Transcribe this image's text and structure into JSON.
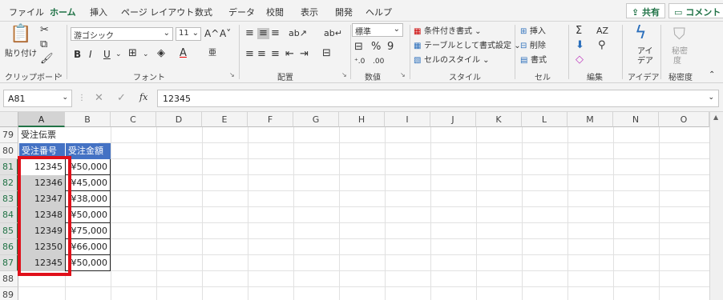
{
  "tabs": [
    "ファイル",
    "ホーム",
    "挿入",
    "ページ レイアウト",
    "数式",
    "データ",
    "校閲",
    "表示",
    "開発",
    "ヘルプ"
  ],
  "share_label": "共有",
  "comment_label": "コメント",
  "ribbon": {
    "clipboard": {
      "paste": "貼り付け",
      "group": "クリップボード"
    },
    "font": {
      "name": "游ゴシック",
      "size": "11",
      "grow": "A^",
      "shrink": "A˅",
      "bold": "B",
      "italic": "I",
      "underline": "U",
      "group": "フォント"
    },
    "alignment": {
      "group": "配置"
    },
    "number": {
      "format": "標準",
      "group": "数値"
    },
    "styles": {
      "conditional": "条件付き書式",
      "table": "テーブルとして書式設定",
      "cell": "セルのスタイル",
      "group": "スタイル"
    },
    "cells": {
      "insert": "挿入",
      "delete": "削除",
      "format": "書式",
      "group": "セル"
    },
    "editing": {
      "group": "編集"
    },
    "ideas": {
      "label1": "アイ",
      "label2": "デア",
      "group": "アイデア"
    },
    "sensitivity": {
      "label1": "秘密",
      "label2": "度",
      "group": "秘密度"
    }
  },
  "formula_bar": {
    "name_box": "A81",
    "fx": "fx",
    "value": "12345"
  },
  "columns": [
    "A",
    "B",
    "C",
    "D",
    "E",
    "F",
    "G",
    "H",
    "I",
    "J",
    "K",
    "L",
    "M",
    "N",
    "O"
  ],
  "rows": [
    "79",
    "80",
    "81",
    "82",
    "83",
    "84",
    "85",
    "86",
    "87",
    "88",
    "89"
  ],
  "sheet": {
    "title": "受注伝票",
    "header_a": "受注番号",
    "header_b": "受注金額",
    "orders": [
      "12345",
      "12346",
      "12347",
      "12348",
      "12349",
      "12350",
      "12345"
    ],
    "amounts": [
      "¥50,000",
      "¥45,000",
      "¥38,000",
      "¥50,000",
      "¥75,000",
      "¥66,000",
      "¥50,000"
    ]
  },
  "colors": {
    "accent": "#217346",
    "table_header": "#4472c4",
    "highlight_box": "#e0101a"
  },
  "icons": [
    "paste-icon",
    "cut-icon",
    "copy-icon",
    "format-painter-icon",
    "bold-icon",
    "italic-icon",
    "underline-icon",
    "borders-icon",
    "fill-color-icon",
    "font-color-icon",
    "phonetic-icon",
    "align-top-icon",
    "align-middle-icon",
    "align-bottom-icon",
    "orientation-icon",
    "wrap-text-icon",
    "align-left-icon",
    "align-center-icon",
    "align-right-icon",
    "decrease-indent-icon",
    "increase-indent-icon",
    "merge-center-icon",
    "currency-icon",
    "percent-icon",
    "comma-icon",
    "increase-decimal-icon",
    "decrease-decimal-icon",
    "conditional-format-icon",
    "format-table-icon",
    "cell-styles-icon",
    "insert-cells-icon",
    "delete-cells-icon",
    "format-cells-icon",
    "autosum-icon",
    "fill-icon",
    "clear-icon",
    "sort-filter-icon",
    "find-icon",
    "ideas-icon",
    "sensitivity-icon",
    "collapse-ribbon-icon"
  ]
}
